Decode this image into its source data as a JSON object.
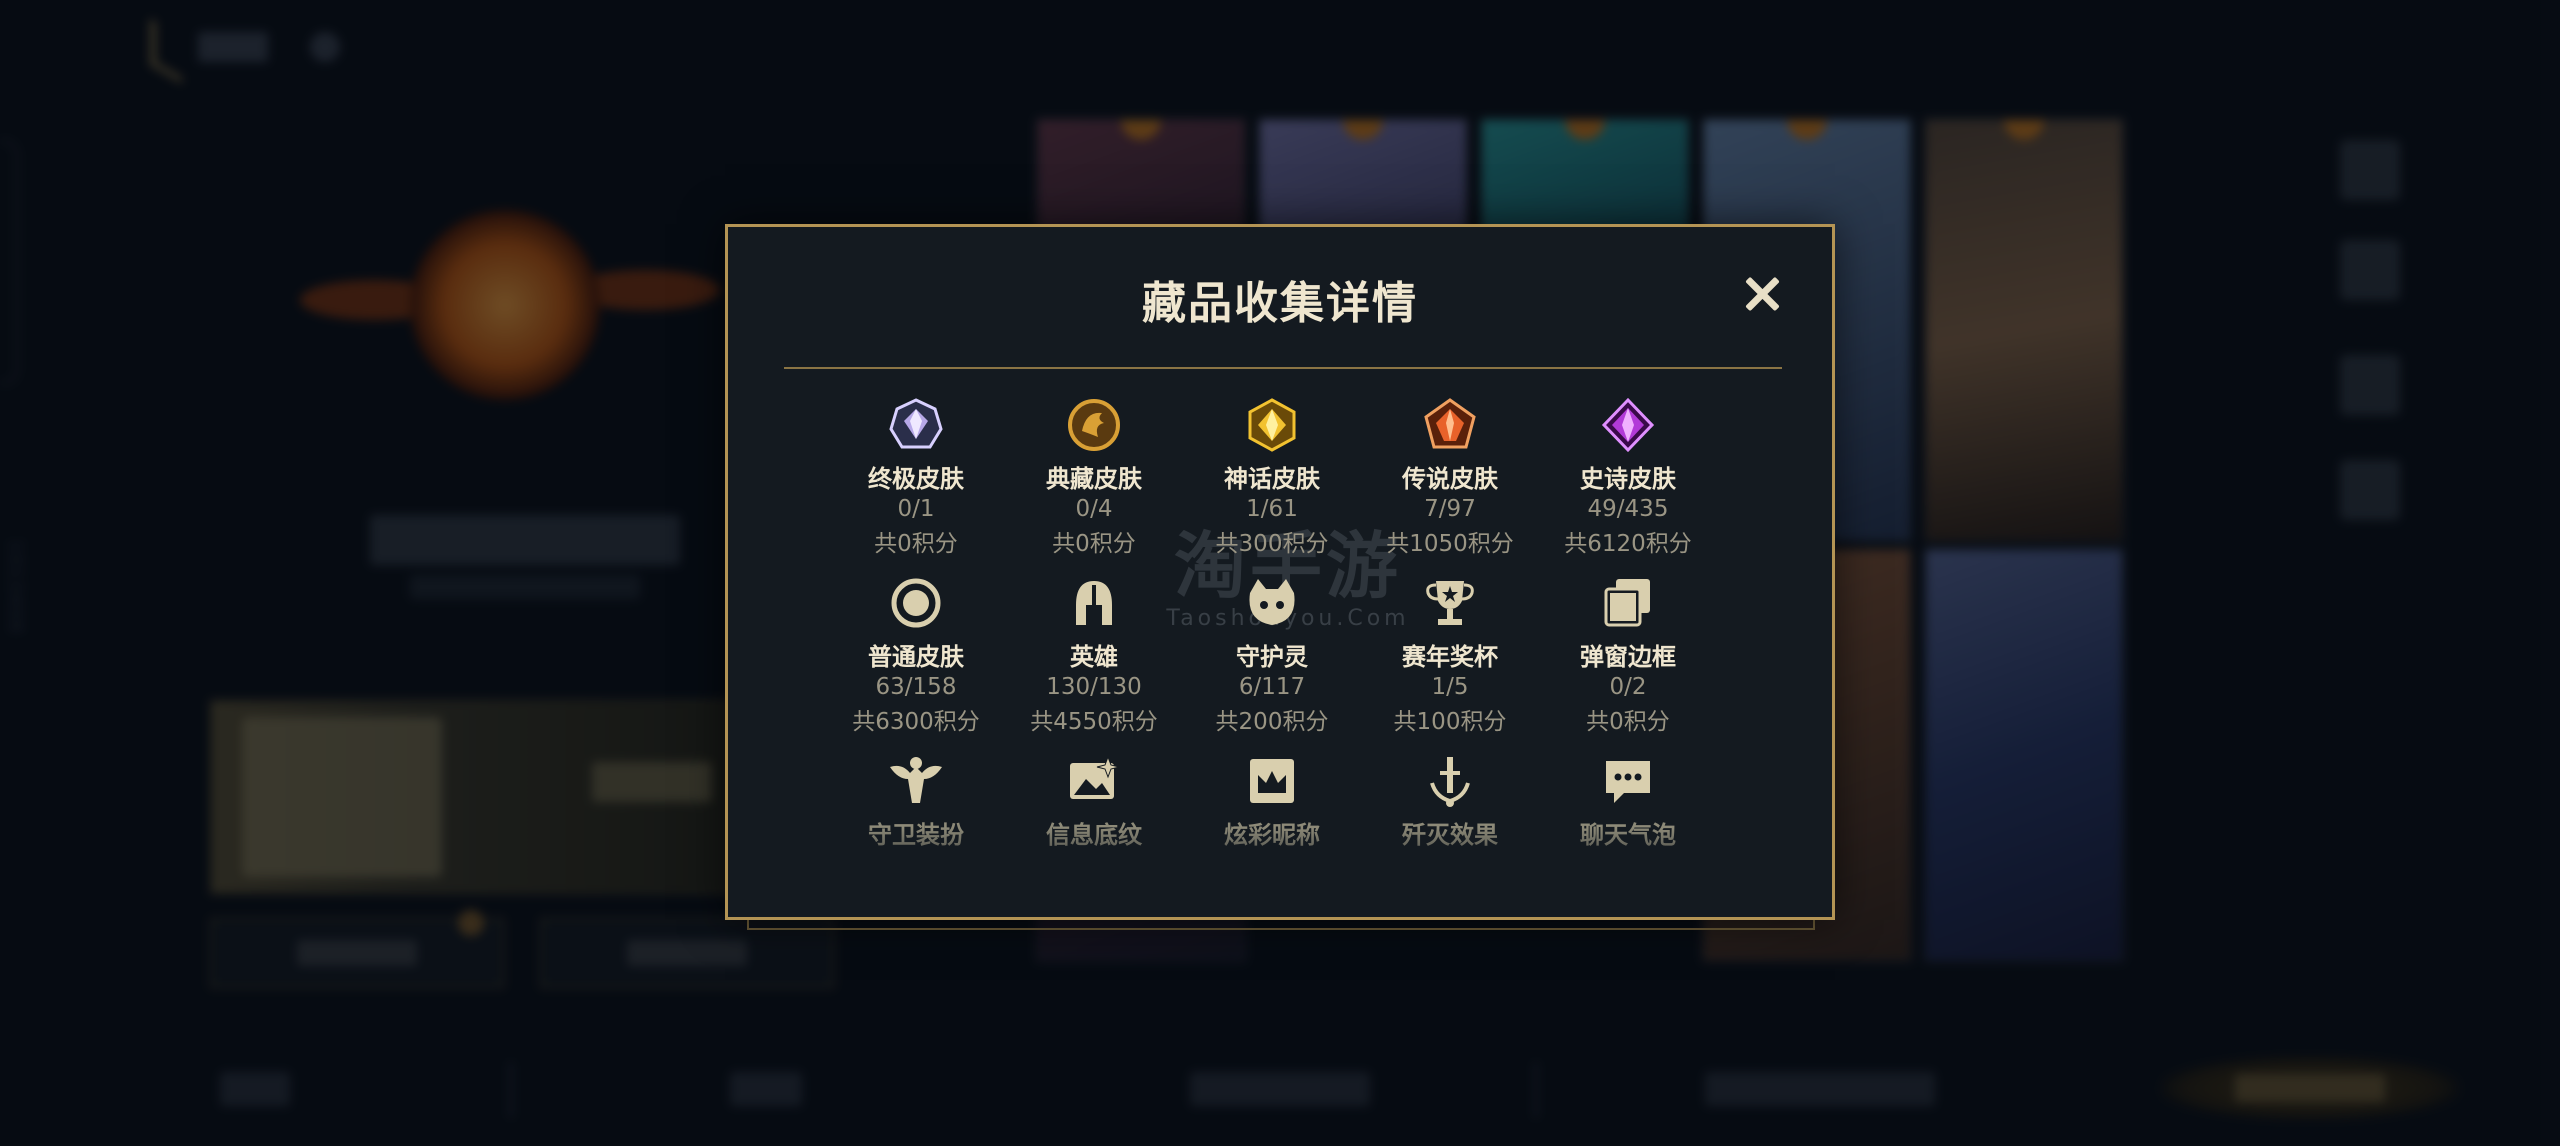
{
  "background": {
    "side_id": "1013408"
  },
  "modal": {
    "title": "藏品收集详情",
    "close_label": "✕",
    "watermark": {
      "cn": "淘手游",
      "en": "Taoshouyou.Com"
    },
    "rows": [
      [
        {
          "key": "ultimate",
          "name": "终极皮肤",
          "count": "0/1",
          "points": "共0积分",
          "icon": "ultimate-gem-icon",
          "color": "#b7a8e8"
        },
        {
          "key": "collectible",
          "name": "典藏皮肤",
          "count": "0/4",
          "points": "共0积分",
          "icon": "dragon-coin-icon",
          "color": "#d9a035"
        },
        {
          "key": "mythic",
          "name": "神话皮肤",
          "count": "1/61",
          "points": "共300积分",
          "icon": "mythic-gem-icon",
          "color": "#f2c230"
        },
        {
          "key": "legendary",
          "name": "传说皮肤",
          "count": "7/97",
          "points": "共1050积分",
          "icon": "legendary-gem-icon",
          "color": "#e8622a"
        },
        {
          "key": "epic",
          "name": "史诗皮肤",
          "count": "49/435",
          "points": "共6120积分",
          "icon": "epic-gem-icon",
          "color": "#b23ad8"
        }
      ],
      [
        {
          "key": "normal",
          "name": "普通皮肤",
          "count": "63/158",
          "points": "共6300积分",
          "icon": "ring-icon",
          "color": "#d9cfae"
        },
        {
          "key": "hero",
          "name": "英雄",
          "count": "130/130",
          "points": "共4550积分",
          "icon": "helmet-icon",
          "color": "#d9cfae"
        },
        {
          "key": "guardian",
          "name": "守护灵",
          "count": "6/117",
          "points": "共200积分",
          "icon": "cat-spirit-icon",
          "color": "#d9cfae"
        },
        {
          "key": "trophy",
          "name": "赛年奖杯",
          "count": "1/5",
          "points": "共100积分",
          "icon": "trophy-icon",
          "color": "#d9cfae"
        },
        {
          "key": "frame",
          "name": "弹窗边框",
          "count": "0/2",
          "points": "共0积分",
          "icon": "stacked-frames-icon",
          "color": "#d9cfae"
        }
      ],
      [
        {
          "key": "guard-outfit",
          "name": "守卫装扮",
          "icon": "guard-figure-icon",
          "color": "#d9cfae"
        },
        {
          "key": "info-pattern",
          "name": "信息底纹",
          "icon": "picture-sparkle-icon",
          "color": "#d9cfae"
        },
        {
          "key": "nickname",
          "name": "炫彩昵称",
          "icon": "crown-card-icon",
          "color": "#d9cfae"
        },
        {
          "key": "kill-effect",
          "name": "歼灭效果",
          "icon": "sword-icon",
          "color": "#d9cfae"
        },
        {
          "key": "chat-bubble",
          "name": "聊天气泡",
          "icon": "chat-bubble-icon",
          "color": "#d9cfae"
        }
      ]
    ]
  },
  "colors": {
    "modal_border": "#b49454",
    "modal_bg": "#141a20",
    "title": "#efe6cf",
    "muted_text": "#9a9584"
  }
}
